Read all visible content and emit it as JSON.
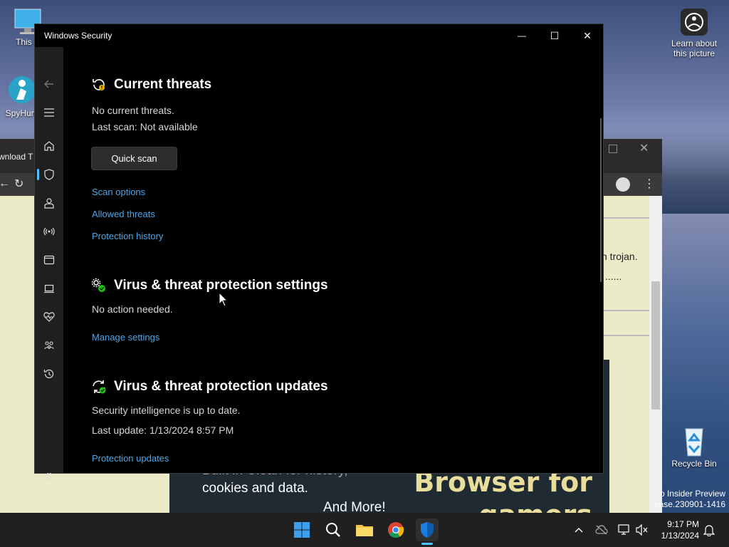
{
  "desktop": {
    "icons": {
      "this_pc": "This P",
      "spyhunter": "SpyHun",
      "learn": "Learn about this picture",
      "recycle_bin": "Recycle Bin"
    },
    "watermark_line1": "o Insider Preview",
    "watermark_line2": "ease.230901-1416"
  },
  "background_window": {
    "tab_fragment": "wnload T",
    "text1": "n trojan.",
    "text2": "......",
    "promo_small": "cookies and data.",
    "promo_small_top": "Built in Clean for history,",
    "promo_more": "And More!",
    "promo_big": "Browser for",
    "promo_big2": "gamers"
  },
  "window": {
    "title": "Windows Security",
    "minimize": "—",
    "maximize": "☐",
    "close": "✕"
  },
  "current_threats": {
    "heading": "Current threats",
    "status": "No current threats.",
    "last_scan": "Last scan: Not available",
    "quick_scan": "Quick scan",
    "links": [
      "Scan options",
      "Allowed threats",
      "Protection history"
    ]
  },
  "settings": {
    "heading": "Virus & threat protection settings",
    "status": "No action needed.",
    "link": "Manage settings"
  },
  "updates": {
    "heading": "Virus & threat protection updates",
    "status": "Security intelligence is up to date.",
    "last_update": "Last update: 1/13/2024 8:57 PM",
    "link": "Protection updates"
  },
  "taskbar": {
    "time": "9:17 PM",
    "date": "1/13/2024"
  },
  "colors": {
    "accent": "#4cc2ff",
    "link": "#4ea6e6"
  }
}
